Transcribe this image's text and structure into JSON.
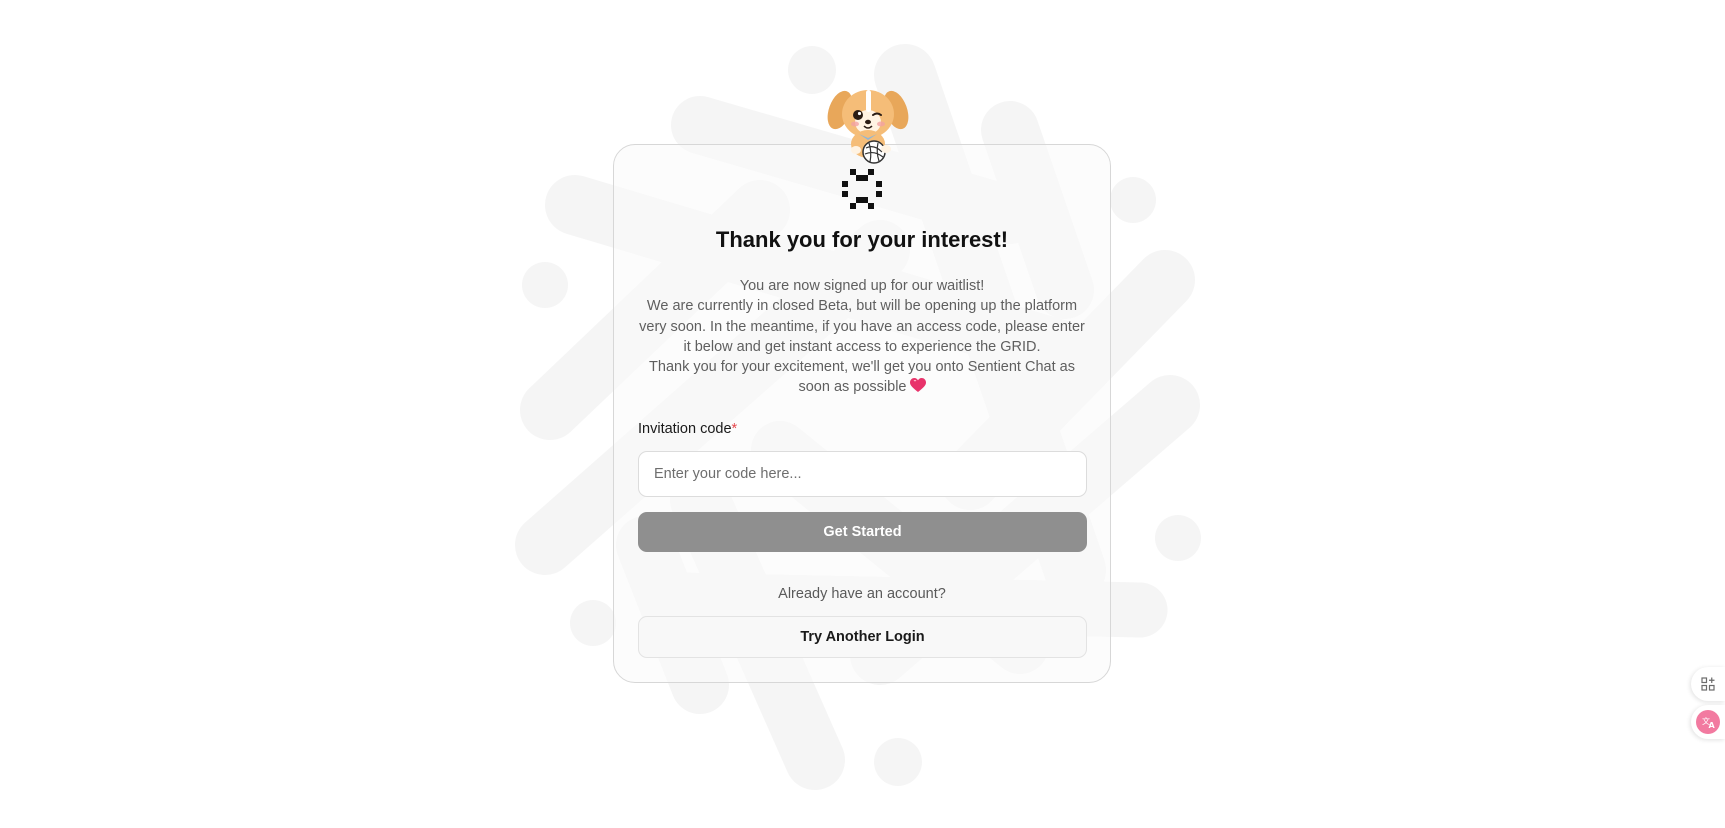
{
  "colors": {
    "accent_button": "#8f8f8f",
    "required_star": "#e5484d",
    "heart": "#e8336b",
    "background_pattern": "#f5f5f5"
  },
  "icons": {
    "mascot": "puppy-mascot-icon",
    "brand_logo": "sentient-grid-logo-icon",
    "heart": "heart-icon",
    "side_apps": "apps-grid-icon",
    "side_translate": "translate-icon"
  },
  "header": {
    "title": "Thank you for your interest!"
  },
  "message": {
    "line1": "You are now signed up for our waitlist!",
    "line2": "We are currently in closed Beta, but will be opening up the platform very soon. In the meantime, if you have an access code, please enter it below and get instant access to experience the GRID.",
    "line3": "Thank you for your excitement, we'll get you onto Sentient Chat as soon as possible"
  },
  "form": {
    "label": "Invitation code",
    "required_marker": "*",
    "placeholder": "Enter your code here...",
    "value": "",
    "submit_label": "Get Started"
  },
  "account": {
    "prompt": "Already have an account?",
    "button_label": "Try Another Login"
  }
}
